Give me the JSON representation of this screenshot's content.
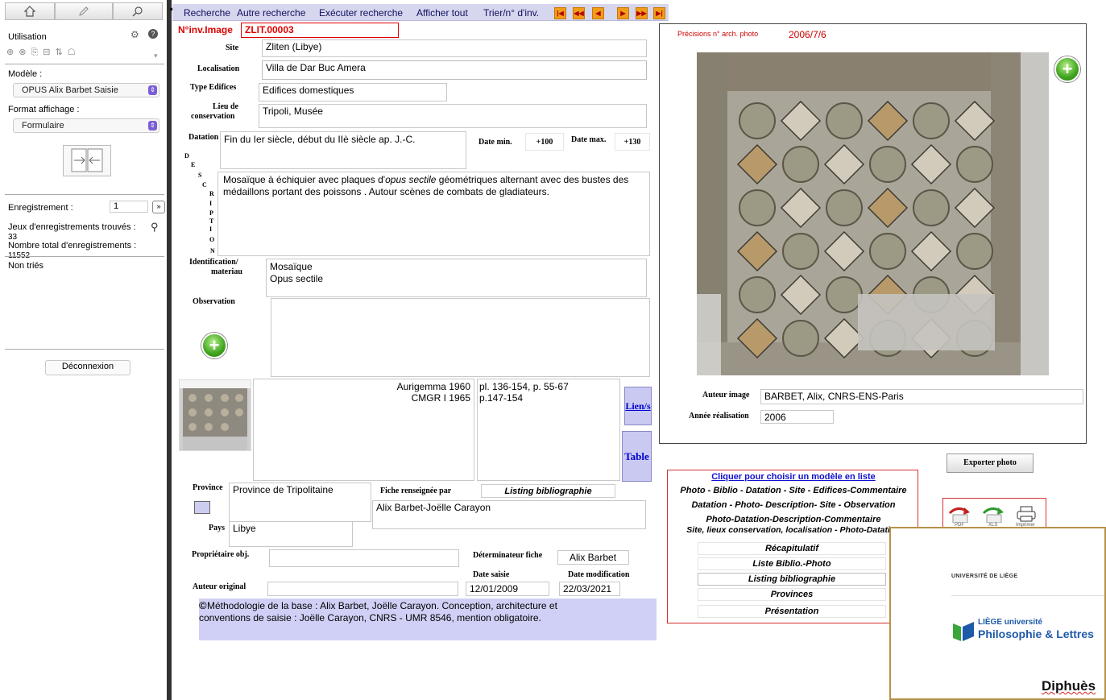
{
  "left_panel": {
    "utilisation": "Utilisation",
    "modele_label": "Modèle :",
    "modele_value": "OPUS Alix Barbet Saisie",
    "format_label": "Format affichage :",
    "format_value": "Formulaire",
    "enreg_label": "Enregistrement :",
    "enreg_value": "1",
    "jeux_label": "Jeux d'enregistrements trouvés :",
    "jeux_value": "33",
    "total_label": "Nombre total d'enregistrements :",
    "total_value": "11552",
    "tri_label": "Non triés",
    "deconnexion": "Déconnexion"
  },
  "menubar": {
    "items": [
      "Recherche",
      "Autre recherche",
      "Exécuter recherche",
      "Afficher tout",
      "Trier/n° d'inv."
    ]
  },
  "form": {
    "ninv_label": "N°inv.Image",
    "ninv_value": "ZLIT.00003",
    "site_label": "Site",
    "site_value": "Zliten (Libye)",
    "localisation_label": "Localisation",
    "localisation_value": "Villa de Dar Buc Amera",
    "type_label": "Type Edifices",
    "type_value": "Edifices domestiques",
    "lieu_label_1": "Lieu de",
    "lieu_label_2": "conservation",
    "lieu_value": "Tripoli, Musée",
    "datation_label": "Datation",
    "datation_value": "Fin du Ier siècle, début du IIè siècle ap. J.-C.",
    "datemin_label": "Date min.",
    "datemin_value": "+100",
    "datemax_label": "Date max.",
    "datemax_value": "+130",
    "description_letters": [
      "D",
      "E",
      "S",
      "C",
      "R",
      "I",
      "P",
      "T",
      "I",
      "O",
      "N"
    ],
    "description_pre": "Mosaïque à échiquier avec plaques d'",
    "description_italic": "opus sectile",
    "description_post": " géométriques alternant avec des bustes des médaillons portant des poissons . Autour scènes de combats de gladiateurs.",
    "ident_label_1": "Identification/",
    "ident_label_2": "materiau",
    "ident_line1": "Mosaïque",
    "ident_line2": "Opus sectile",
    "observation_label": "Observation",
    "observation_value": "",
    "biblio_authors_1": "Aurigemma 1960",
    "biblio_authors_2": "CMGR I 1965",
    "biblio_pages_1": "pl. 136-154, p. 55-67",
    "biblio_pages_2": "p.147-154",
    "lien_button": "Lien/s",
    "table_button": "Table",
    "province_label": "Province",
    "province_value": "Province de Tripolitaine",
    "fiche_label": "Fiche renseignée par",
    "fiche_value": "Alix Barbet-Joëlle Carayon",
    "listing_button": "Listing bibliographie",
    "pays_label": "Pays",
    "pays_value": "Libye",
    "proprietaire_label": "Propriétaire obj.",
    "proprietaire_value": "",
    "determinateur_label": "Déterminateur fiche",
    "determinateur_value": "Alix Barbet",
    "auteur_orig_label": "Auteur original",
    "auteur_orig_value": "",
    "date_saisie_label": "Date saisie",
    "date_saisie_value": "12/01/2009",
    "date_modif_label": "Date modification",
    "date_modif_value": "22/03/2021",
    "copyright_symbol": "©",
    "copyright_text": "Méthodologie de la base : Alix Barbet, Joëlle Carayon. Conception, architecture et conventions de saisie : Joëlle Carayon, CNRS - UMR 8546, mention obligatoire."
  },
  "photo": {
    "precisions_label": "Précisions n° arch. photo",
    "precisions_value": "2006/7/6",
    "auteur_label": "Auteur image",
    "auteur_value": "BARBET, Alix, CNRS-ENS-Paris",
    "annee_label": "Année réalisation",
    "annee_value": "2006",
    "export_button": "Exporter photo"
  },
  "models": {
    "title": "Cliquer pour choisir un modèle en liste",
    "items": [
      "Photo - Biblio - Datation - Site - Edifices-Commentaire",
      "Datation - Photo- Description- Site - Observation",
      "Photo-Datation-Description-Commentaire",
      "Site, lieux conservation, localisation - Photo-Datation"
    ],
    "buttons": [
      "Récapitulatif",
      "Liste Biblio.-Photo",
      "Listing bibliographie",
      "Provinces",
      "Présentation"
    ]
  },
  "export": {
    "pdf": "PDF",
    "xls": "XLS",
    "print": "Imprimer"
  },
  "ulg": {
    "univ": "UNIVERSITÉ DE LIÈGE",
    "liege": "LIÈGE université",
    "faculty": "Philosophie & Lettres",
    "footer": "Diphuès"
  },
  "colors": {
    "accent_red": "#e00000",
    "menu_bg": "#d6d6ee",
    "nav_orange": "#f29d1a",
    "liege_green": "#3aa53a",
    "liege_blue": "#1e5aa8"
  }
}
